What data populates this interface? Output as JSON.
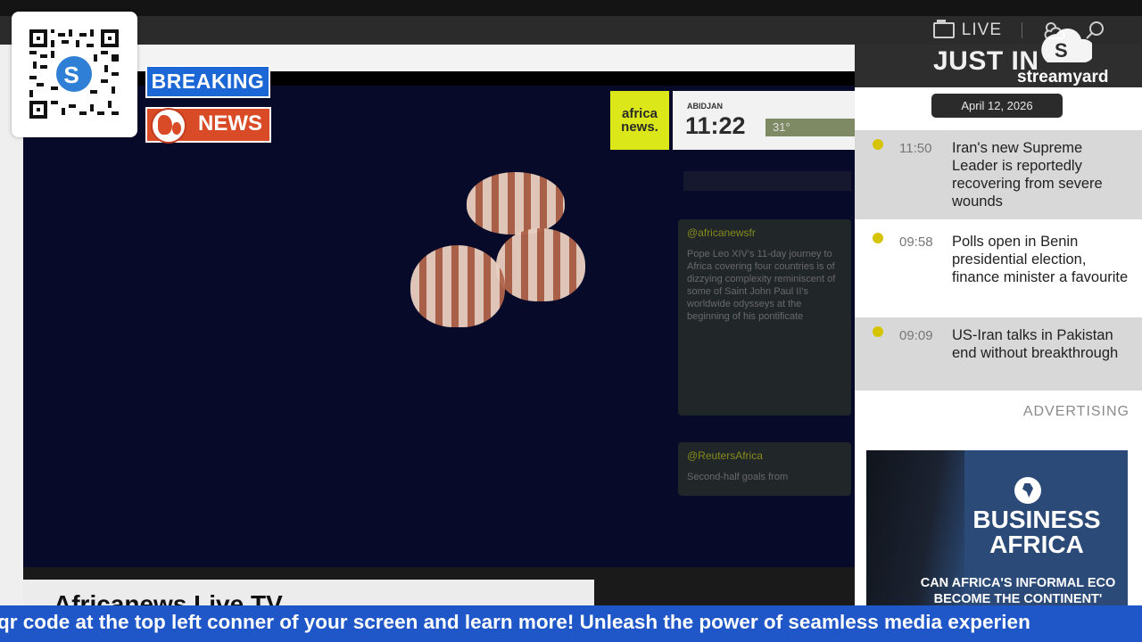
{
  "header": {
    "live_label": "LIVE",
    "icons": [
      "tv-icon",
      "weather-icon",
      "search-icon"
    ]
  },
  "overlay": {
    "breaking_label": "BREAKING",
    "news_label": "NEWS",
    "qr_icon": "qr-code",
    "streamyard_label": "streamyard"
  },
  "video": {
    "caption": "Africanews Live TV",
    "channel_logo": [
      "africa",
      "news."
    ],
    "clock_city": "ABIDJAN",
    "clock_time": "11:22",
    "temperature": "31°",
    "tweets": [
      {
        "handle": "@africanewsfr",
        "body": "Pope Leo XIV's 11-day journey to Africa covering four countries is of dizzying complexity reminiscent of some of Saint John Paul II's worldwide odysseys at the beginning of his pontificate"
      },
      {
        "handle": "@ReutersAfrica",
        "body": "Second-half goals from"
      }
    ]
  },
  "panel": {
    "title": "JUST IN",
    "date": "April 12, 2026",
    "items": [
      {
        "time": "11:50",
        "title": "Iran's new Supreme Leader is reportedly recovering from severe wounds"
      },
      {
        "time": "09:58",
        "title": "Polls open in Benin presidential election, finance minister a favourite"
      },
      {
        "time": "09:09",
        "title": "US-Iran talks in Pakistan end without breakthrough"
      }
    ],
    "advertising_label": "ADVERTISING",
    "ad": {
      "title": "BUSINESS AFRICA",
      "subtitle_line1": "CAN AFRICA'S INFORMAL ECO",
      "subtitle_line2": "BECOME THE CONTINENT'"
    }
  },
  "ticker": {
    "text": "qr code at the top left conner of your screen and learn more! Unleash the power of seamless media experien"
  },
  "colors": {
    "breaking_blue": "#1b67d6",
    "news_red": "#d94a27",
    "ticker_blue": "#1f57c8",
    "africanews_yellow": "#dce719"
  }
}
